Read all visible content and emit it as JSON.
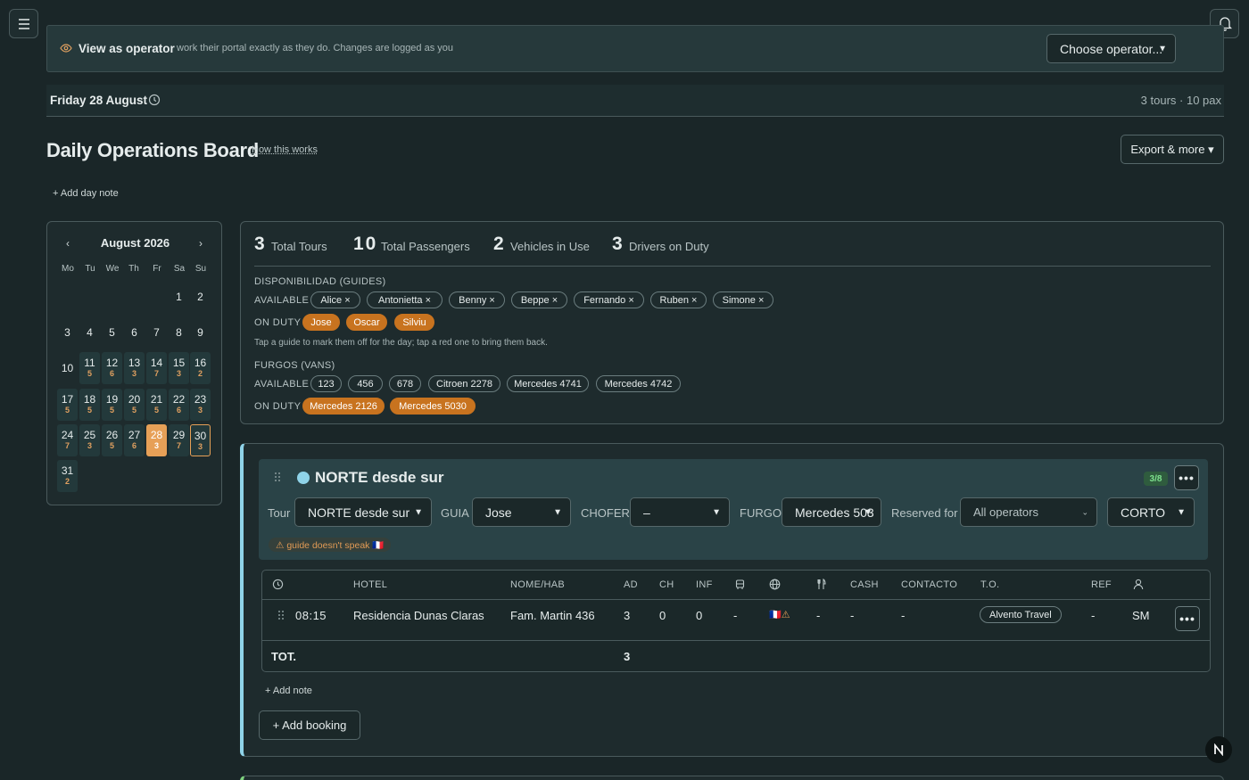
{
  "banner": {
    "title": "View as operator",
    "subtitle": "work their portal exactly as they do. Changes are logged as you",
    "operator_select": "Choose operator..."
  },
  "dateline": {
    "date": "Friday 28 August",
    "summary": "3 tours · 10 pax"
  },
  "page": {
    "title": "Daily Operations Board",
    "how_link": "How this works",
    "export_button": "Export & more ▾",
    "add_day_note": "+ Add day note"
  },
  "calendar": {
    "month": "August 2026",
    "prev": "‹",
    "next": "›",
    "weekdays": [
      "Mo",
      "Tu",
      "We",
      "Th",
      "Fr",
      "Sa",
      "Su"
    ],
    "days": [
      {
        "n": "1",
        "c": ""
      },
      {
        "n": "2",
        "c": ""
      },
      {
        "n": "3",
        "c": ""
      },
      {
        "n": "4",
        "c": ""
      },
      {
        "n": "5",
        "c": ""
      },
      {
        "n": "6",
        "c": ""
      },
      {
        "n": "7",
        "c": ""
      },
      {
        "n": "8",
        "c": ""
      },
      {
        "n": "9",
        "c": ""
      },
      {
        "n": "10",
        "c": ""
      },
      {
        "n": "11",
        "c": "5"
      },
      {
        "n": "12",
        "c": "6"
      },
      {
        "n": "13",
        "c": "3"
      },
      {
        "n": "14",
        "c": "7"
      },
      {
        "n": "15",
        "c": "3"
      },
      {
        "n": "16",
        "c": "2"
      },
      {
        "n": "17",
        "c": "5"
      },
      {
        "n": "18",
        "c": "5"
      },
      {
        "n": "19",
        "c": "5"
      },
      {
        "n": "20",
        "c": "5"
      },
      {
        "n": "21",
        "c": "5"
      },
      {
        "n": "22",
        "c": "6"
      },
      {
        "n": "23",
        "c": "3"
      },
      {
        "n": "24",
        "c": "7"
      },
      {
        "n": "25",
        "c": "3"
      },
      {
        "n": "26",
        "c": "5"
      },
      {
        "n": "27",
        "c": "6"
      },
      {
        "n": "28",
        "c": "3"
      },
      {
        "n": "29",
        "c": "7"
      },
      {
        "n": "30",
        "c": "3"
      },
      {
        "n": "31",
        "c": "2"
      }
    ],
    "selected_day": "28",
    "today_day": "30"
  },
  "stats": {
    "tours_n": "3",
    "tours_l": "Total Tours",
    "pax_n": "10",
    "pax_l": "Total Passengers",
    "vehicles_n": "2",
    "vehicles_l": "Vehicles in Use",
    "drivers_n": "3",
    "drivers_l": "Drivers on Duty"
  },
  "guides": {
    "section": "DISPONIBILIDAD (GUIDES)",
    "available_label": "AVAILABLE",
    "on_duty_label": "ON DUTY",
    "available": [
      "Alice ×",
      "Antonietta ×",
      "Benny ×",
      "Beppe ×",
      "Fernando ×",
      "Ruben ×",
      "Simone ×"
    ],
    "on_duty": [
      "Jose",
      "Oscar",
      "Silviu"
    ],
    "hint": "Tap a guide to mark them off for the day; tap a red one to bring them back."
  },
  "vans": {
    "section": "FURGOS (VANS)",
    "available_label": "AVAILABLE",
    "on_duty_label": "ON DUTY",
    "available": [
      "123",
      "456",
      "678",
      "Citroen 2278",
      "Mercedes 4741",
      "Mercedes 4742"
    ],
    "on_duty": [
      "Mercedes 2126",
      "Mercedes 5030"
    ]
  },
  "tour": {
    "name": "NORTE desde sur",
    "capacity_badge": "3/8",
    "more": "•••",
    "labels": {
      "tour": "Tour",
      "guia": "GUIA",
      "chofer": "CHOFER",
      "furgo": "FURGO",
      "reserved": "Reserved for"
    },
    "values": {
      "tour": "NORTE desde sur",
      "guia": "Jose",
      "chofer": "–",
      "furgo": "Mercedes 503",
      "reserved": "All operators",
      "type": "CORTO"
    },
    "warning": "⚠ guide doesn't speak 🇫🇷",
    "table": {
      "headers": {
        "hotel": "HOTEL",
        "name": "NOME/HAB",
        "ad": "AD",
        "ch": "CH",
        "inf": "INF",
        "cash": "CASH",
        "contacto": "CONTACTO",
        "to": "T.O.",
        "ref": "REF"
      },
      "row": {
        "time": "08:15",
        "hotel": "Residencia Dunas Claras",
        "name": "Fam. Martin 436",
        "ad": "3",
        "ch": "0",
        "inf": "0",
        "bus": "-",
        "lang": "🇫🇷⚠",
        "meal": "-",
        "cash": "-",
        "contacto": "-",
        "to": "Alvento Travel",
        "ref": "-",
        "user": "SM"
      },
      "total_label": "TOT.",
      "total_ad": "3"
    },
    "add_note": "+ Add note",
    "add_booking": "+ Add booking"
  },
  "fab_label": "N"
}
